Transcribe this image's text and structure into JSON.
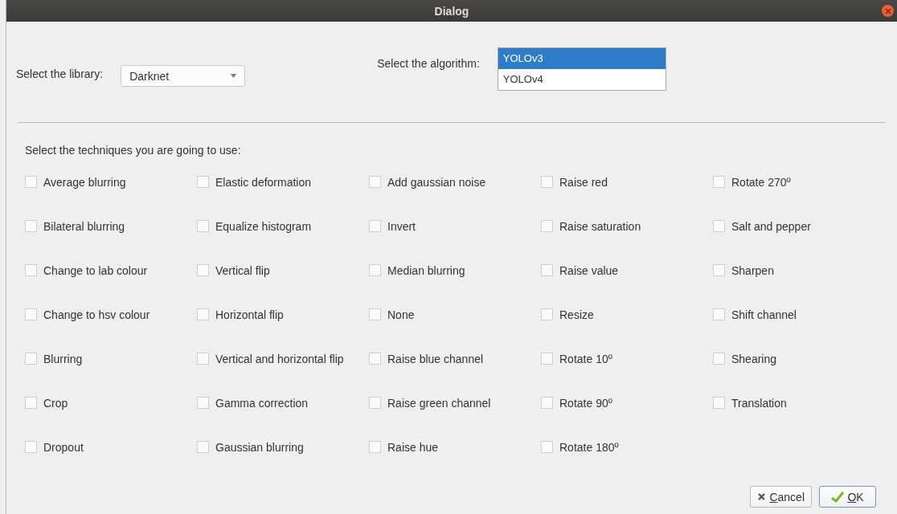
{
  "window": {
    "title": "Dialog"
  },
  "library": {
    "label": "Select the library:",
    "value": "Darknet"
  },
  "algorithm": {
    "label": "Select the algorithm:",
    "options": [
      {
        "label": "YOLOv3",
        "selected": true
      },
      {
        "label": "YOLOv4",
        "selected": false
      }
    ]
  },
  "techniques_label": "Select the techniques you are going to use:",
  "technique_columns": [
    [
      {
        "label": "Average blurring",
        "checked": false
      },
      {
        "label": "Bilateral blurring",
        "checked": false
      },
      {
        "label": "Change to lab colour",
        "checked": false
      },
      {
        "label": "Change to hsv colour",
        "checked": false
      },
      {
        "label": "Blurring",
        "checked": false
      },
      {
        "label": "Crop",
        "checked": false
      },
      {
        "label": "Dropout",
        "checked": false
      }
    ],
    [
      {
        "label": "Elastic deformation",
        "checked": false
      },
      {
        "label": "Equalize histogram",
        "checked": false
      },
      {
        "label": "Vertical flip",
        "checked": false
      },
      {
        "label": "Horizontal flip",
        "checked": false
      },
      {
        "label": "Vertical and horizontal flip",
        "checked": false
      },
      {
        "label": "Gamma correction",
        "checked": false
      },
      {
        "label": "Gaussian blurring",
        "checked": false
      }
    ],
    [
      {
        "label": "Add gaussian noise",
        "checked": false
      },
      {
        "label": "Invert",
        "checked": false
      },
      {
        "label": "Median blurring",
        "checked": false
      },
      {
        "label": "None",
        "checked": false
      },
      {
        "label": "Raise blue channel",
        "checked": false
      },
      {
        "label": "Raise green channel",
        "checked": false
      },
      {
        "label": "Raise hue",
        "checked": false
      }
    ],
    [
      {
        "label": "Raise red",
        "checked": false
      },
      {
        "label": "Raise saturation",
        "checked": false
      },
      {
        "label": "Raise value",
        "checked": false
      },
      {
        "label": "Resize",
        "checked": false
      },
      {
        "label": "Rotate 10º",
        "checked": false
      },
      {
        "label": "Rotate 90º",
        "checked": false
      },
      {
        "label": "Rotate 180º",
        "checked": false
      }
    ],
    [
      {
        "label": "Rotate 270º",
        "checked": false
      },
      {
        "label": "Salt and pepper",
        "checked": false
      },
      {
        "label": "Sharpen",
        "checked": false
      },
      {
        "label": "Shift channel",
        "checked": false
      },
      {
        "label": "Shearing",
        "checked": false
      },
      {
        "label": "Translation",
        "checked": false
      }
    ]
  ],
  "buttons": [
    {
      "kind": "cancel",
      "mnemonic": "C",
      "rest": "ancel"
    },
    {
      "kind": "ok",
      "mnemonic": "O",
      "rest": "K"
    }
  ]
}
